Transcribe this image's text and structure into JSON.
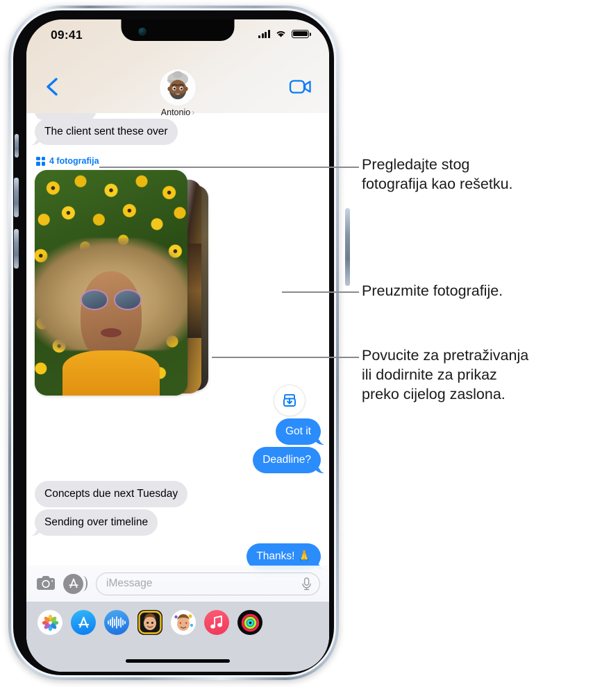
{
  "device": {
    "name": "iPhone",
    "app": "Messages"
  },
  "status_bar": {
    "time": "09:41",
    "cellular_icon": "cellular-bars-icon",
    "wifi_icon": "wifi-icon",
    "battery_icon": "battery-full-icon"
  },
  "header": {
    "back_icon": "back-chevron-icon",
    "facetime_icon": "facetime-video-icon",
    "contact_name": "Antonio",
    "contact_chevron": "›",
    "avatar_icon": "memoji-avatar"
  },
  "conversation": {
    "messages": [
      {
        "id": "m0",
        "text": "",
        "side": "them",
        "partial": true
      },
      {
        "id": "m1",
        "text": "The client sent these over",
        "side": "them"
      },
      {
        "id": "m2",
        "text": "Got it",
        "side": "me"
      },
      {
        "id": "m3",
        "text": "Deadline?",
        "side": "me"
      },
      {
        "id": "m4",
        "text": "Concepts due next Tuesday",
        "side": "them"
      },
      {
        "id": "m5",
        "text": "Sending over timeline",
        "side": "them"
      },
      {
        "id": "m6",
        "text": "Thanks! 🙏",
        "side": "me"
      }
    ],
    "photo_stack": {
      "grid_icon": "grid-four-squares-icon",
      "count_label": "4 fotografija",
      "save_icon": "save-to-photos-icon"
    }
  },
  "input_bar": {
    "camera_icon": "camera-icon",
    "appstore_icon": "app-store-icon",
    "placeholder": "iMessage",
    "mic_icon": "microphone-icon"
  },
  "app_drawer": {
    "apps": [
      {
        "name": "photos-app",
        "icon": "photos-icon"
      },
      {
        "name": "app-store-app",
        "icon": "app-store-icon"
      },
      {
        "name": "audio-message-app",
        "icon": "audio-waveform-icon"
      },
      {
        "name": "memoji-stickers-app",
        "icon": "memoji-sticker-icon"
      },
      {
        "name": "memoji-app",
        "icon": "memoji-hearts-icon"
      },
      {
        "name": "music-app",
        "icon": "music-note-icon"
      },
      {
        "name": "fitness-app",
        "icon": "activity-rings-icon"
      }
    ],
    "home_indicator": "home-indicator"
  },
  "callouts": [
    {
      "id": "c1",
      "line1": "Pregledajte stog",
      "line2": "fotografija kao rešetku.",
      "line3": ""
    },
    {
      "id": "c2",
      "line1": "Preuzmite fotografije.",
      "line2": "",
      "line3": ""
    },
    {
      "id": "c3",
      "line1": "Povucite za pretraživanja",
      "line2": "ili dodirnite za prikaz",
      "line3": "preko cijelog zaslona."
    }
  ],
  "colors": {
    "accent_blue": "#0a7cf5",
    "bubble_me": "#2b8cfc",
    "bubble_them": "#e6e5ea",
    "leader_line": "#8a8a8e"
  }
}
